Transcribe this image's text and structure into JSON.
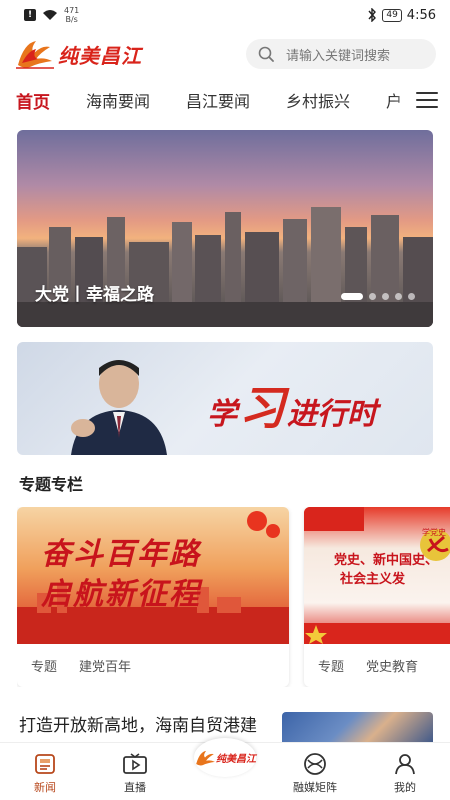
{
  "status_bar": {
    "network_speed_value": "471",
    "network_speed_unit": "B/s",
    "battery": "49",
    "time": "4:56"
  },
  "header": {
    "logo_text": "纯美昌江",
    "search_placeholder": "请输入关键词搜索"
  },
  "tabs": [
    {
      "label": "首页",
      "active": true
    },
    {
      "label": "海南要闻",
      "active": false
    },
    {
      "label": "昌江要闻",
      "active": false
    },
    {
      "label": "乡村振兴",
      "active": false
    },
    {
      "label": "户",
      "active": false
    }
  ],
  "hero": {
    "caption": "大党丨幸福之路",
    "slides": 5,
    "active_slide": 1
  },
  "study_banner": {
    "text_part1": "学",
    "text_part2": "习",
    "text_part3": "进行时"
  },
  "section": {
    "title": "专题专栏"
  },
  "cards": [
    {
      "image_title_line1": "奋斗百年路",
      "image_title_line2": "启航新征程",
      "tag": "专题",
      "name": "建党百年"
    },
    {
      "image_title_line1": "党史、新中国史、",
      "image_title_line2": "社会主义发",
      "badge": "学党史",
      "tag": "专题",
      "name": "党史教育"
    }
  ],
  "news": {
    "title": "打造开放新高地，海南自贸港建设蓬勃兴起"
  },
  "bottom_nav": {
    "items": [
      {
        "label": "新闻",
        "active": true
      },
      {
        "label": "直播",
        "active": false
      },
      {
        "label": "纯美昌江",
        "active": false
      },
      {
        "label": "融媒矩阵",
        "active": false
      },
      {
        "label": "我的",
        "active": false
      }
    ]
  },
  "colors": {
    "brand_red": "#c7161e",
    "nav_active": "#b8481c"
  }
}
